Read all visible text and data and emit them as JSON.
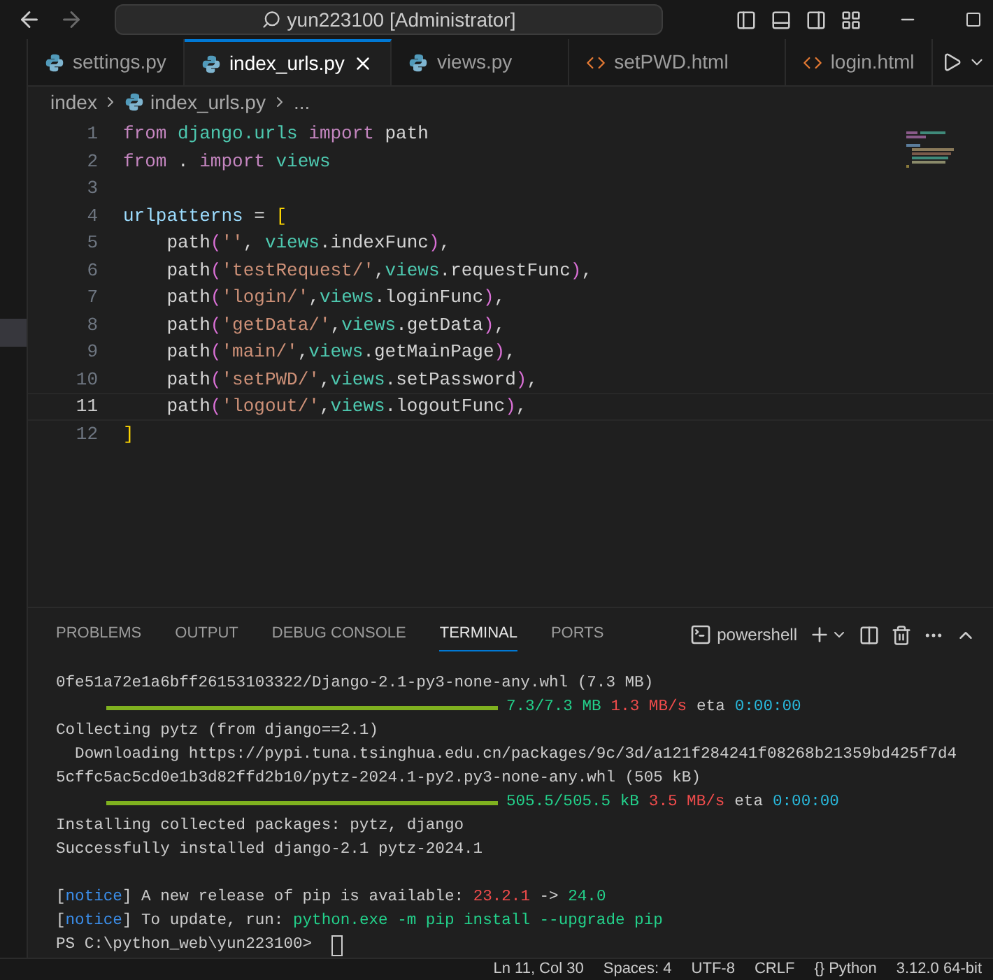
{
  "title_bar": {
    "search": "yun223100 [Administrator]"
  },
  "tabs": [
    {
      "label": "settings.py",
      "kind": "python",
      "selected": false
    },
    {
      "label": "index_urls.py",
      "kind": "python",
      "selected": true
    },
    {
      "label": "views.py",
      "kind": "python",
      "selected": false
    },
    {
      "label": "setPWD.html",
      "kind": "html",
      "selected": false
    },
    {
      "label": "login.html",
      "kind": "html",
      "selected": false
    }
  ],
  "breadcrumbs": [
    "index",
    "index_urls.py",
    "..."
  ],
  "code_lines": [
    {
      "number": "1",
      "current": false,
      "tokens": [
        {
          "kind": "keyword",
          "text": "from "
        },
        {
          "kind": "module",
          "text": "django.urls "
        },
        {
          "kind": "keyword",
          "text": "import"
        },
        {
          "kind": "plain",
          "text": " path"
        }
      ]
    },
    {
      "number": "2",
      "current": false,
      "tokens": [
        {
          "kind": "keyword",
          "text": "from"
        },
        {
          "kind": "plain",
          "text": " . "
        },
        {
          "kind": "keyword",
          "text": "import "
        },
        {
          "kind": "module",
          "text": "views"
        }
      ]
    },
    {
      "number": "3",
      "current": false
    },
    {
      "number": "4",
      "current": false,
      "tokens": [
        {
          "kind": "variable",
          "text": "urlpatterns"
        },
        {
          "kind": "plain",
          "text": " = "
        },
        {
          "kind": "bracket",
          "text": "["
        }
      ]
    },
    {
      "number": "5",
      "current": false,
      "tokens": [
        {
          "kind": "plain",
          "text": "    path"
        },
        {
          "kind": "paren",
          "text": "("
        },
        {
          "kind": "string",
          "text": "''"
        },
        {
          "kind": "plain",
          "text": ", "
        },
        {
          "kind": "module",
          "text": "views"
        },
        {
          "kind": "plain",
          "text": ".indexFunc"
        },
        {
          "kind": "paren",
          "text": ")"
        },
        {
          "kind": "plain",
          "text": ","
        }
      ]
    },
    {
      "number": "6",
      "current": false,
      "tokens": [
        {
          "kind": "plain",
          "text": "    path"
        },
        {
          "kind": "paren",
          "text": "("
        },
        {
          "kind": "string",
          "text": "'testRequest/'"
        },
        {
          "kind": "plain",
          "text": ","
        },
        {
          "kind": "module",
          "text": "views"
        },
        {
          "kind": "plain",
          "text": ".requestFunc"
        },
        {
          "kind": "paren",
          "text": ")"
        },
        {
          "kind": "plain",
          "text": ","
        }
      ]
    },
    {
      "number": "7",
      "current": false,
      "tokens": [
        {
          "kind": "plain",
          "text": "    path"
        },
        {
          "kind": "paren",
          "text": "("
        },
        {
          "kind": "string",
          "text": "'login/'"
        },
        {
          "kind": "plain",
          "text": ","
        },
        {
          "kind": "module",
          "text": "views"
        },
        {
          "kind": "plain",
          "text": ".loginFunc"
        },
        {
          "kind": "paren",
          "text": ")"
        },
        {
          "kind": "plain",
          "text": ","
        }
      ]
    },
    {
      "number": "8",
      "current": false,
      "tokens": [
        {
          "kind": "plain",
          "text": "    path"
        },
        {
          "kind": "paren",
          "text": "("
        },
        {
          "kind": "string",
          "text": "'getData/'"
        },
        {
          "kind": "plain",
          "text": ","
        },
        {
          "kind": "module",
          "text": "views"
        },
        {
          "kind": "plain",
          "text": ".getData"
        },
        {
          "kind": "paren",
          "text": ")"
        },
        {
          "kind": "plain",
          "text": ","
        }
      ]
    },
    {
      "number": "9",
      "current": false,
      "tokens": [
        {
          "kind": "plain",
          "text": "    path"
        },
        {
          "kind": "paren",
          "text": "("
        },
        {
          "kind": "string",
          "text": "'main/'"
        },
        {
          "kind": "plain",
          "text": ","
        },
        {
          "kind": "module",
          "text": "views"
        },
        {
          "kind": "plain",
          "text": ".getMainPage"
        },
        {
          "kind": "paren",
          "text": ")"
        },
        {
          "kind": "plain",
          "text": ","
        }
      ]
    },
    {
      "number": "10",
      "current": false,
      "tokens": [
        {
          "kind": "plain",
          "text": "    path"
        },
        {
          "kind": "paren",
          "text": "("
        },
        {
          "kind": "string",
          "text": "'setPWD/'"
        },
        {
          "kind": "plain",
          "text": ","
        },
        {
          "kind": "module",
          "text": "views"
        },
        {
          "kind": "plain",
          "text": ".setPassword"
        },
        {
          "kind": "paren",
          "text": ")"
        },
        {
          "kind": "plain",
          "text": ","
        }
      ]
    },
    {
      "number": "11",
      "current": true,
      "tokens": [
        {
          "kind": "plain",
          "text": "    path"
        },
        {
          "kind": "paren",
          "text": "("
        },
        {
          "kind": "string",
          "text": "'logout/'"
        },
        {
          "kind": "plain",
          "text": ","
        },
        {
          "kind": "module",
          "text": "views"
        },
        {
          "kind": "plain",
          "text": ".logoutFunc"
        },
        {
          "kind": "paren",
          "text": ")"
        },
        {
          "kind": "plain",
          "text": ","
        }
      ]
    },
    {
      "number": "12",
      "current": false,
      "tokens": [
        {
          "kind": "bracket",
          "text": "]"
        }
      ]
    }
  ],
  "panel_tabs": [
    {
      "label": "PROBLEMS",
      "selected": false
    },
    {
      "label": "OUTPUT",
      "selected": false
    },
    {
      "label": "DEBUG CONSOLE",
      "selected": false
    },
    {
      "label": "TERMINAL",
      "selected": true
    },
    {
      "label": "PORTS",
      "selected": false
    }
  ],
  "terminal_profile": "powershell",
  "terminal_lines": [
    {
      "segments": [
        {
          "kind": "plain",
          "text": "0fe51a72e1a6bff26153103322/Django-2.1-py3-none-any.whl (7.3 MB)"
        }
      ]
    },
    {
      "segments": [
        {
          "kind": "bar",
          "level": 1
        },
        {
          "kind": "green",
          "text": "7.3/7.3 MB"
        },
        {
          "kind": "red",
          "text": "1.3 MB/s"
        },
        {
          "kind": "plain",
          "text": "eta"
        },
        {
          "kind": "cyan",
          "text": "0:00:00"
        }
      ]
    },
    {
      "segments": [
        {
          "kind": "plain",
          "text": "Collecting pytz (from django==2.1)"
        }
      ]
    },
    {
      "segments": [
        {
          "kind": "plain",
          "text": "  Downloading https://pypi.tuna.tsinghua.edu.cn/packages/9c/3d/a121f284241f08268b21359bd425f7d4"
        }
      ]
    },
    {
      "segments": [
        {
          "kind": "plain",
          "text": "5cffc5ac5cd0e1b3d82ffd2b10/pytz-2024.1-py2.py3-none-any.whl (505 kB)"
        }
      ]
    },
    {
      "segments": [
        {
          "kind": "bar",
          "level": 1
        },
        {
          "kind": "green",
          "text": "505.5/505.5 kB"
        },
        {
          "kind": "red",
          "text": "3.5 MB/s"
        },
        {
          "kind": "plain",
          "text": "eta"
        },
        {
          "kind": "cyan",
          "text": "0:00:00"
        }
      ]
    },
    {
      "segments": [
        {
          "kind": "plain",
          "text": "Installing collected packages: pytz, django"
        }
      ]
    },
    {
      "segments": [
        {
          "kind": "plain",
          "text": "Successfully installed django-2.1 pytz-2024.1"
        }
      ]
    },
    {
      "gap_before": true,
      "segments": [
        {
          "kind": "plain",
          "text": "["
        },
        {
          "kind": "blue",
          "text": "notice"
        },
        {
          "kind": "plain",
          "text": "] A new release of pip is available: "
        },
        {
          "kind": "red",
          "text": "23.2.1"
        },
        {
          "kind": "plain",
          "text": " -> "
        },
        {
          "kind": "green",
          "text": "24.0"
        }
      ]
    },
    {
      "segments": [
        {
          "kind": "plain",
          "text": "["
        },
        {
          "kind": "blue",
          "text": "notice"
        },
        {
          "kind": "plain",
          "text": "] To update, run: "
        },
        {
          "kind": "green",
          "text": "python.exe -m pip install --upgrade pip"
        }
      ]
    },
    {
      "segments": [
        {
          "kind": "plain",
          "text": "PS C:\\python_web\\yun223100> "
        },
        {
          "kind": "cursor"
        }
      ]
    }
  ],
  "status_bar": [
    "Ln 11, Col 30",
    "Spaces: 4",
    "UTF-8",
    "CRLF",
    "{} Python",
    "3.12.0 64-bit"
  ]
}
